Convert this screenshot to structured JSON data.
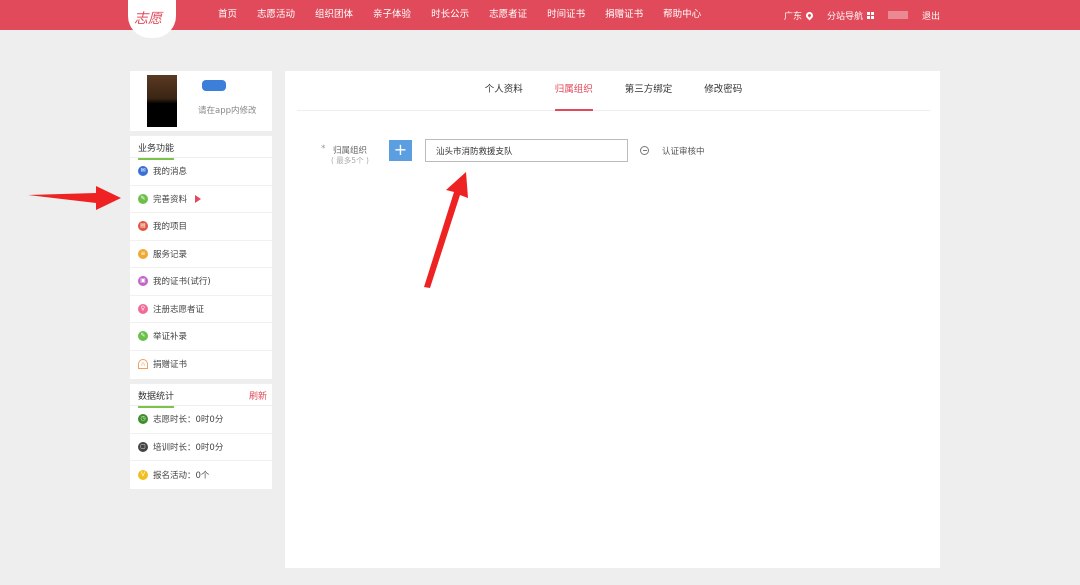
{
  "header": {
    "logo": "志愿",
    "nav": [
      "首页",
      "志愿活动",
      "组织团体",
      "亲子体验",
      "时长公示",
      "志愿者证",
      "时间证书",
      "捐赠证书",
      "帮助中心"
    ],
    "region": "广东",
    "site_nav": "分站导航",
    "logout": "退出"
  },
  "profile": {
    "modify_tip": "请在app内修改"
  },
  "business": {
    "title": "业务功能",
    "items": [
      {
        "label": "我的消息",
        "icon": "message-icon",
        "color": "#3b6fd8"
      },
      {
        "label": "完善资料",
        "icon": "edit-icon",
        "color": "#6cc04a"
      },
      {
        "label": "我的项目",
        "icon": "project-icon",
        "color": "#e0553f"
      },
      {
        "label": "服务记录",
        "icon": "record-icon",
        "color": "#f0a830"
      },
      {
        "label": "我的证书(试行)",
        "icon": "certificate-icon",
        "color": "#c064c8"
      },
      {
        "label": "注册志愿者证",
        "icon": "register-icon",
        "color": "#f06a9a"
      },
      {
        "label": "举证补录",
        "icon": "supplement-icon",
        "color": "#6cc04a"
      },
      {
        "label": "捐赠证书",
        "icon": "donation-icon",
        "color": "#f0a060"
      }
    ]
  },
  "stats": {
    "title": "数据统计",
    "refresh": "刷新",
    "items": [
      {
        "label": "志愿时长：0时0分",
        "icon": "clock-icon",
        "color": "#3e8e2a"
      },
      {
        "label": "培训时长：0时0分",
        "icon": "training-icon",
        "color": "#444444"
      },
      {
        "label": "报名活动：0个",
        "icon": "activity-icon",
        "color": "#f0c020"
      }
    ]
  },
  "tabs": [
    "个人资料",
    "归属组织",
    "第三方绑定",
    "修改密码"
  ],
  "form": {
    "required_mark": "*",
    "label": "归属组织",
    "hint": "( 最多5个 )",
    "add": "+",
    "org_value": "汕头市消防救援支队",
    "status": "认证审核中"
  },
  "colors": {
    "header": "#e14a5a",
    "accent": "#e14a5a",
    "add_button": "#5b9fe0",
    "section_underline": "#7cc34a"
  }
}
